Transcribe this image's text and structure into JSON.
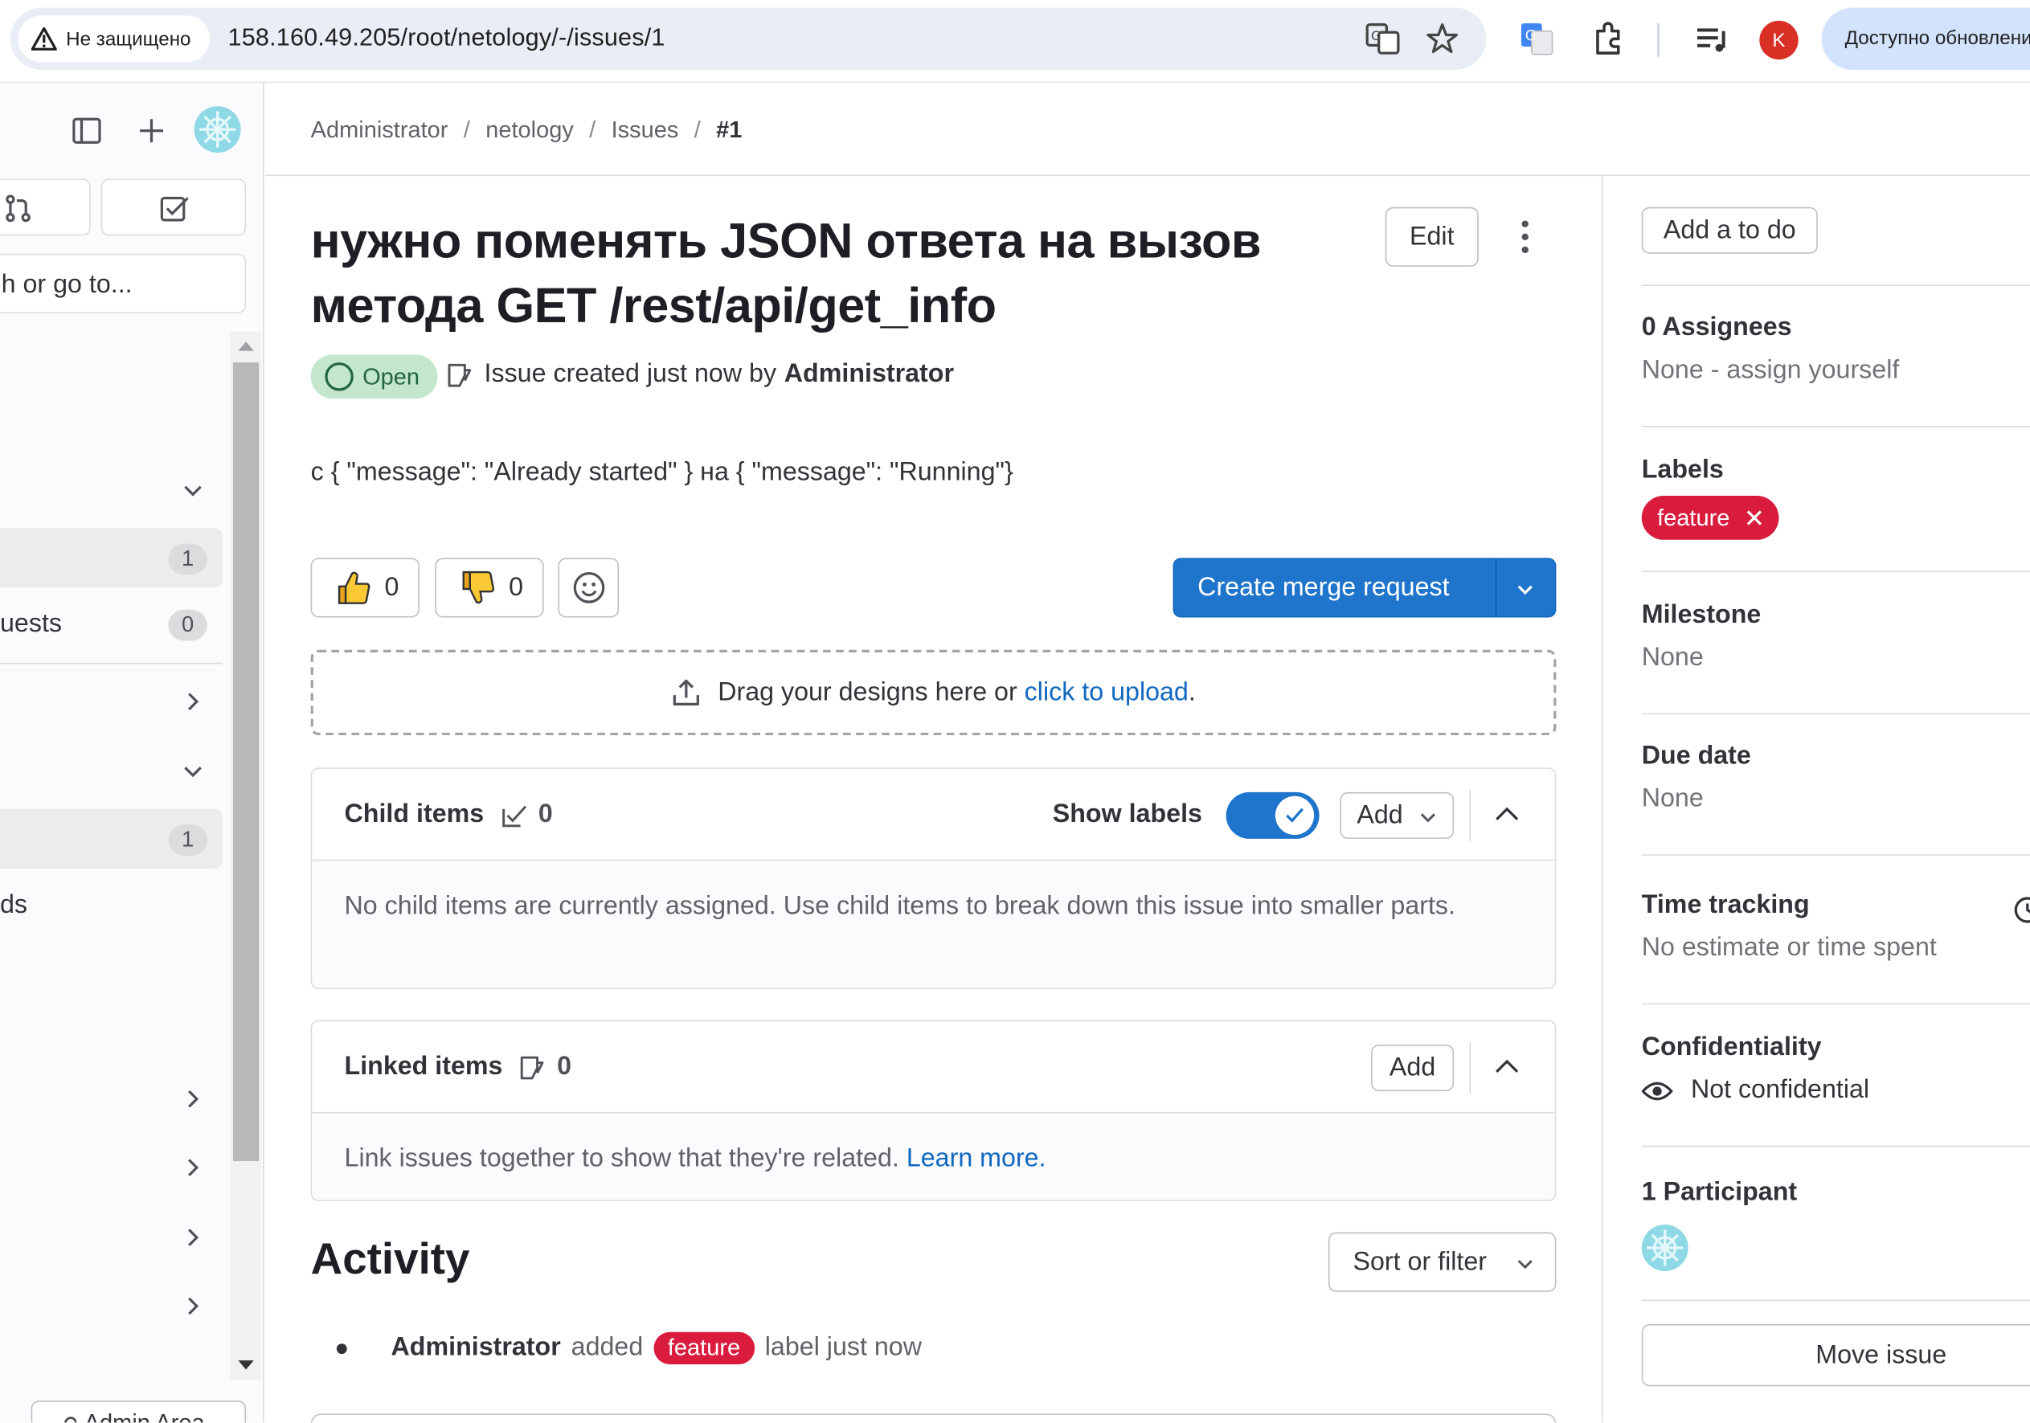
{
  "browser": {
    "security_label": "Не защищено",
    "url": "158.160.49.205/root/netology/-/issues/1",
    "avatar_letter": "K",
    "update_label": "Доступно обновление"
  },
  "sidebar": {
    "search_placeholder": "h or go to...",
    "items": [
      {
        "count": "1"
      },
      {
        "label": "uests",
        "count": "0"
      },
      {
        "count": "1"
      },
      {
        "label": "ds"
      }
    ],
    "admin_area": "Admin Area"
  },
  "breadcrumb": {
    "items": [
      "Administrator",
      "netology",
      "Issues",
      "#1"
    ],
    "separator": "/"
  },
  "issue": {
    "title": "нужно поменять JSON ответа на вызов метода GET /rest/api/get_info",
    "edit_label": "Edit",
    "status": "Open",
    "meta_prefix": "Issue created just now by",
    "author": "Administrator",
    "description": "с { \"message\": \"Already started\" } на { \"message\": \"Running\"}",
    "thumbs_up_count": "0",
    "thumbs_down_count": "0",
    "create_mr_label": "Create merge request",
    "design_drop_text": "Drag your designs here or",
    "design_drop_link": "click to upload",
    "design_drop_end": "."
  },
  "child_items": {
    "title": "Child items",
    "count": "0",
    "show_labels": "Show labels",
    "show_labels_on": true,
    "add_label": "Add",
    "empty_text": "No child items are currently assigned. Use child items to break down this issue into smaller parts."
  },
  "linked_items": {
    "title": "Linked items",
    "count": "0",
    "add_label": "Add",
    "empty_text": "Link issues together to show that they're related.",
    "learn_more": "Learn more."
  },
  "activity": {
    "title": "Activity",
    "sort_label": "Sort or filter",
    "entry_user": "Administrator",
    "entry_action": "added",
    "entry_label": "feature",
    "entry_suffix": "label just now"
  },
  "right_sidebar": {
    "add_todo": "Add a to do",
    "assignees_title": "0 Assignees",
    "assignees_value": "None - assign yourself",
    "labels_title": "Labels",
    "label_name": "feature",
    "milestone_title": "Milestone",
    "milestone_value": "None",
    "due_title": "Due date",
    "due_value": "None",
    "time_title": "Time tracking",
    "time_value": "No estimate or time spent",
    "conf_title": "Confidentiality",
    "conf_value": "Not confidential",
    "participants_title": "1 Participant",
    "move_issue": "Move issue"
  },
  "colors": {
    "primary": "#1f75cb",
    "label_feature": "#d91c3d",
    "open_bg": "#c3e6cd",
    "open_fg": "#24663b"
  }
}
